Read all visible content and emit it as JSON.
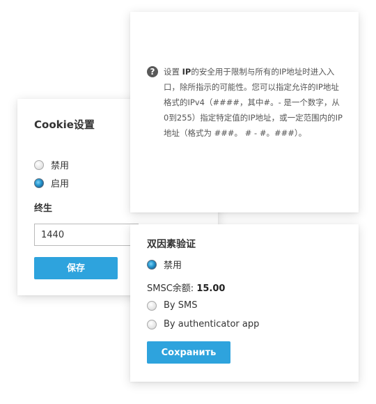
{
  "cookie": {
    "title": "Cookie设置",
    "options": [
      {
        "label": "禁用",
        "checked": false
      },
      {
        "label": "启用",
        "checked": true
      }
    ],
    "lifetime_label": "终生",
    "lifetime_value": "1440",
    "save_label": "保存"
  },
  "ip_security": {
    "help_icon": "question-circle-icon",
    "text_prefix": "设置 ",
    "text_bold": "IP",
    "text_body": "的安全用于限制与所有的IP地址时进入入口，除所指示的可能性。您可以指定允许的IP地址格式的IPv4（####，其中#。- 是一个数字，从0到255）指定特定值的IP地址，或一定范围内的IP地址（格式为 ###。 # - #。###）。"
  },
  "twofa": {
    "title": "双因素验证",
    "options": [
      {
        "label": "禁用",
        "checked": true
      },
      {
        "label": "By SMS",
        "checked": false
      },
      {
        "label": "By authenticator app",
        "checked": false
      }
    ],
    "smsc_label": "SMSC余额: ",
    "smsc_value": "15.00",
    "save_label": "Сохранить"
  },
  "colors": {
    "accent": "#2ea3dd",
    "radio_checked": "#1b6fa5"
  }
}
